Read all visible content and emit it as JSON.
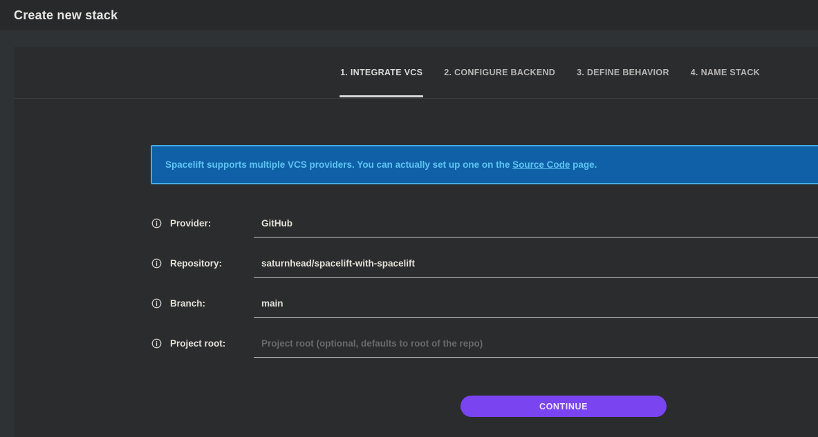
{
  "header": {
    "title": "Create new stack"
  },
  "stepper": {
    "tabs": [
      {
        "label": "1. INTEGRATE VCS",
        "active": true
      },
      {
        "label": "2. CONFIGURE BACKEND",
        "active": false
      },
      {
        "label": "3. DEFINE BEHAVIOR",
        "active": false
      },
      {
        "label": "4. NAME STACK",
        "active": false
      }
    ]
  },
  "banner": {
    "text_before_link": "Spacelift supports multiple VCS providers. You can actually set up one on the ",
    "link_text": "Source Code",
    "text_after_link": " page.",
    "background_color": "#0f60a7",
    "border_color": "#45aee5",
    "text_color": "#5ec4f2"
  },
  "form": {
    "fields": [
      {
        "label": "Provider:",
        "value": "GitHub",
        "placeholder": ""
      },
      {
        "label": "Repository:",
        "value": "saturnhead/spacelift-with-spacelift",
        "placeholder": ""
      },
      {
        "label": "Branch:",
        "value": "main",
        "placeholder": ""
      },
      {
        "label": "Project root:",
        "value": "",
        "placeholder": "Project root (optional, defaults to root of the repo)"
      }
    ]
  },
  "actions": {
    "continue_label": "CONTINUE",
    "button_color": "#7b44f1"
  }
}
